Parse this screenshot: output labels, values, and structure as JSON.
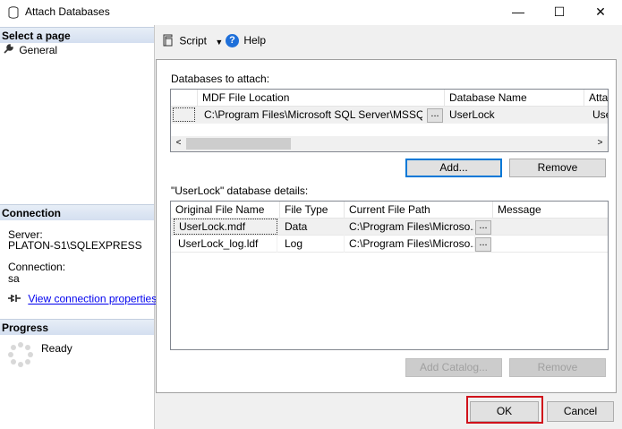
{
  "window": {
    "title": "Attach Databases",
    "minimize_glyph": "—",
    "maximize_glyph": "☐",
    "close_glyph": "✕"
  },
  "left": {
    "select_page": "Select a page",
    "pages": [
      {
        "label": "General",
        "icon": "wrench-icon"
      }
    ],
    "connection_header": "Connection",
    "server_label": "Server:",
    "server_value": "PLATON-S1\\SQLEXPRESS",
    "connection_label": "Connection:",
    "connection_value": "sa",
    "view_props": "View connection properties",
    "progress_header": "Progress",
    "progress_status": "Ready"
  },
  "toolbar": {
    "script_label": "Script",
    "help_label": "Help"
  },
  "attach": {
    "label": "Databases to attach:",
    "columns": [
      "MDF File Location",
      "Database Name",
      "Atta"
    ],
    "rows": [
      {
        "location": "C:\\Program Files\\Microsoft SQL Server\\MSSQL...",
        "ellipsis": "...",
        "name": "UserLock",
        "attach_as": "Use"
      }
    ],
    "add_button": "Add...",
    "remove_button": "Remove"
  },
  "details": {
    "label": "\"UserLock\" database details:",
    "columns": [
      "Original File Name",
      "File Type",
      "Current File Path",
      "Message"
    ],
    "rows": [
      {
        "original": "UserLock.mdf",
        "type": "Data",
        "path": "C:\\Program Files\\Microso...",
        "ellipsis": "...",
        "message": ""
      },
      {
        "original": "UserLock_log.ldf",
        "type": "Log",
        "path": "C:\\Program Files\\Microso...",
        "ellipsis": "...",
        "message": ""
      }
    ],
    "add_catalog_button": "Add Catalog...",
    "remove_button": "Remove"
  },
  "footer": {
    "ok_label": "OK",
    "cancel_label": "Cancel",
    "highlight_color": "#d0121b"
  }
}
